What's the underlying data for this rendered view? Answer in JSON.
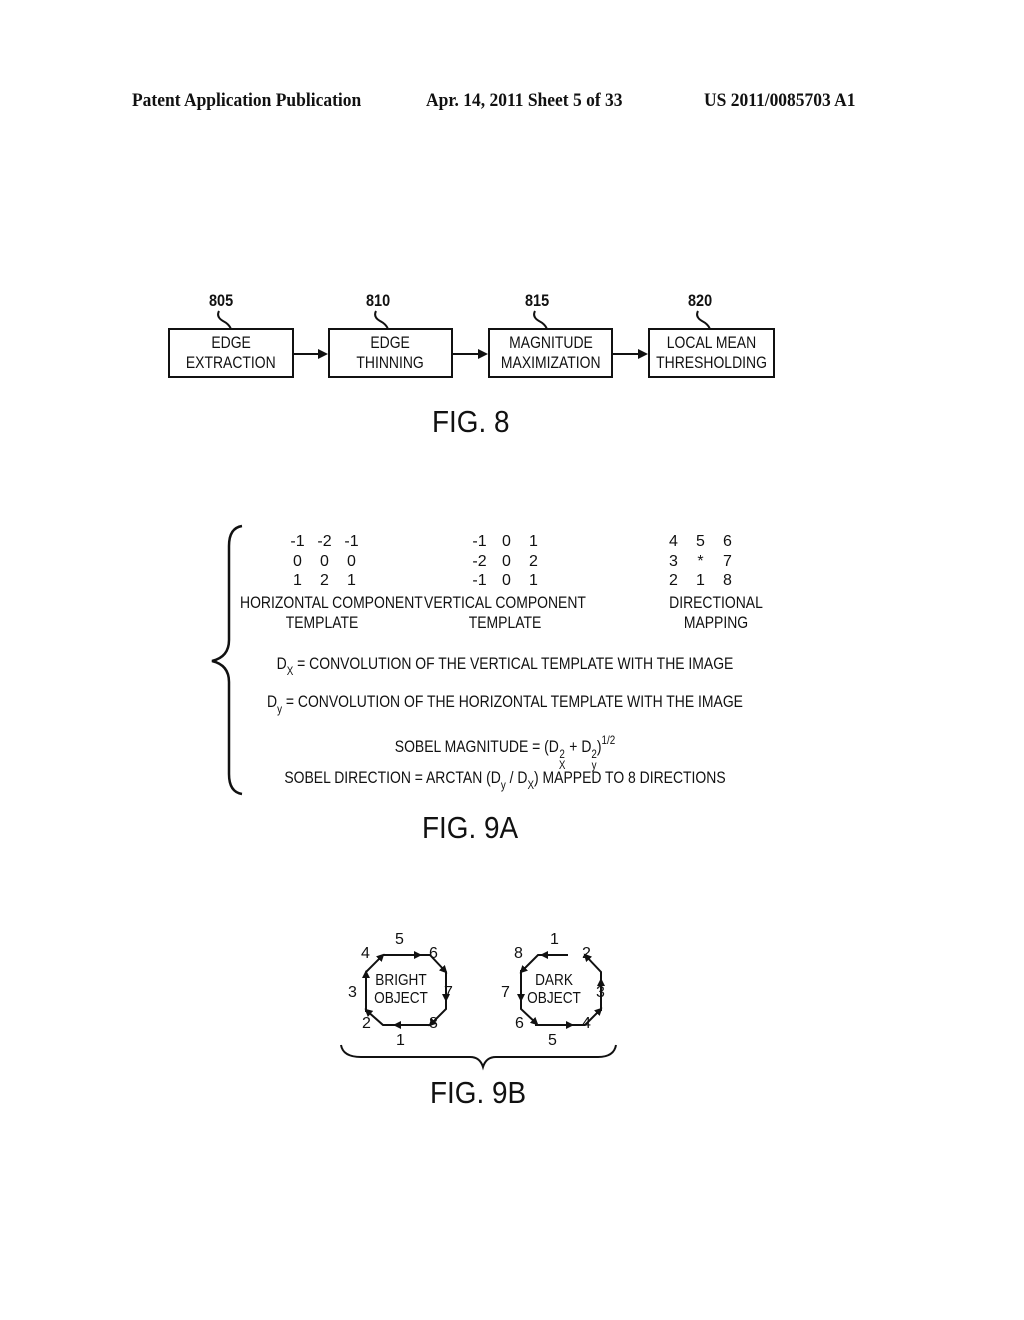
{
  "header": {
    "publication": "Patent Application Publication",
    "date_sheet": "Apr. 14, 2011  Sheet 5 of 33",
    "number": "US 2011/0085703 A1"
  },
  "fig8": {
    "label": "FIG. 8",
    "blocks": [
      {
        "ref": "805",
        "line1": "EDGE",
        "line2": "EXTRACTION"
      },
      {
        "ref": "810",
        "line1": "EDGE",
        "line2": "THINNING"
      },
      {
        "ref": "815",
        "line1": "MAGNITUDE",
        "line2": "MAXIMIZATION"
      },
      {
        "ref": "820",
        "line1": "LOCAL MEAN",
        "line2": "THRESHOLDING"
      }
    ]
  },
  "fig9a": {
    "label": "FIG. 9A",
    "horizontal_template": {
      "rows": [
        [
          "-1",
          "-2",
          "-1"
        ],
        [
          "0",
          "0",
          "0"
        ],
        [
          "1",
          "2",
          "1"
        ]
      ],
      "caption1": "HORIZONTAL COMPONENT",
      "caption2": "TEMPLATE"
    },
    "vertical_template": {
      "rows": [
        [
          "-1",
          "0",
          "1"
        ],
        [
          "-2",
          "0",
          "2"
        ],
        [
          "-1",
          "0",
          "1"
        ]
      ],
      "caption1": "VERTICAL COMPONENT",
      "caption2": "TEMPLATE"
    },
    "directional_mapping": {
      "rows": [
        [
          "4",
          "5",
          "6"
        ],
        [
          "3",
          "*",
          "7"
        ],
        [
          "2",
          "1",
          "8"
        ]
      ],
      "caption1": "DIRECTIONAL",
      "caption2": "MAPPING"
    },
    "equations": {
      "dx": {
        "lhs": "D",
        "lhs_sub": "X",
        "rhs": " = CONVOLUTION OF THE VERTICAL TEMPLATE WITH THE IMAGE"
      },
      "dy": {
        "lhs": "D",
        "lhs_sub": "y",
        "rhs": " = CONVOLUTION OF THE HORIZONTAL TEMPLATE WITH THE IMAGE"
      },
      "magnitude": {
        "prefix": "SOBEL MAGNITUDE = (D",
        "sq1": "2",
        "sub1": "X",
        "mid": " + D",
        "sq2": "2",
        "sub2": "y",
        "close": ")",
        "exp": "1/2"
      },
      "direction": {
        "prefix": "SOBEL DIRECTION = ARCTAN (D",
        "sub1": "y",
        "mid": " / D",
        "sub2": "X",
        "suffix": ") MAPPED TO 8 DIRECTIONS"
      }
    }
  },
  "fig9b": {
    "label": "FIG. 9B",
    "bright": {
      "line1": "BRIGHT",
      "line2": "OBJECT",
      "dirs": {
        "top": "5",
        "top_right": "6",
        "right": "7",
        "bottom_right": "8",
        "bottom": "1",
        "bottom_left": "2",
        "left": "3",
        "top_left": "4"
      }
    },
    "dark": {
      "line1": "DARK",
      "line2": "OBJECT",
      "dirs": {
        "top": "1",
        "top_right": "2",
        "right": "3",
        "bottom_right": "4",
        "bottom": "5",
        "bottom_left": "6",
        "left": "7",
        "top_left": "8"
      }
    }
  }
}
